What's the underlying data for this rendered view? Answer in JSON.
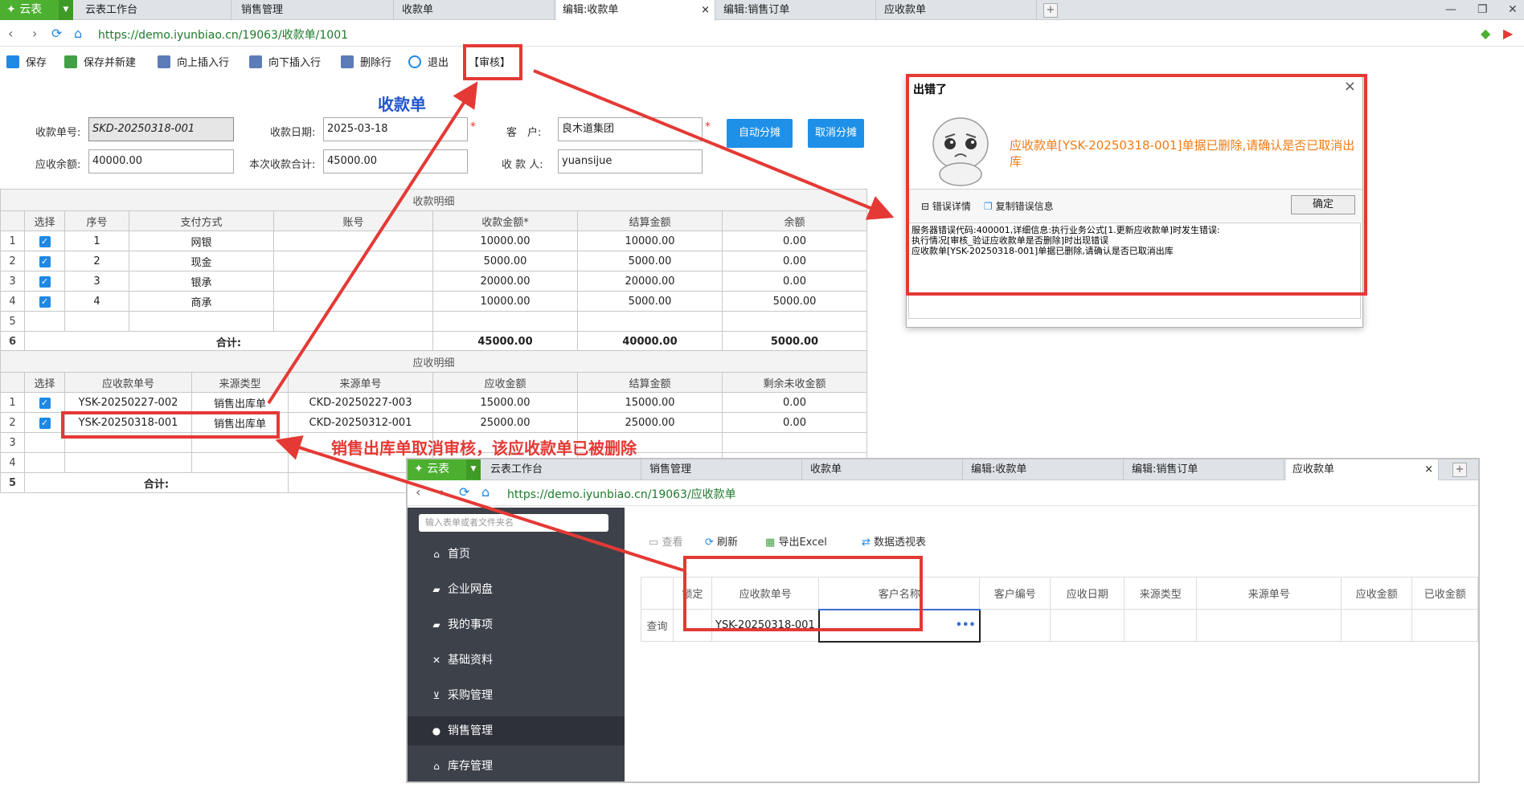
{
  "browser": {
    "app_label": "云表",
    "tabs": [
      {
        "label": "云表工作台",
        "active": false
      },
      {
        "label": "销售管理",
        "active": false
      },
      {
        "label": "收款单",
        "active": false
      },
      {
        "label": "编辑:收款单",
        "active": true
      },
      {
        "label": "编辑:销售订单",
        "active": false
      },
      {
        "label": "应收款单",
        "active": false
      }
    ],
    "close_glyph": "×",
    "url": "https://demo.iyunbiao.cn/19063/收款单/1001"
  },
  "toolbar": {
    "save": "保存",
    "save_new": "保存并新建",
    "insert_up": "向上插入行",
    "insert_down": "向下插入行",
    "delete_row": "删除行",
    "exit": "退出",
    "audit": "【审核】"
  },
  "form": {
    "title": "收款单",
    "doc_no_label": "收款单号:",
    "doc_no": "SKD-20250318-001",
    "date_label": "收款日期:",
    "date": "2025-03-18",
    "customer_label": "客　户:",
    "customer": "良木道集团",
    "balance_label": "应收余额:",
    "balance": "40000.00",
    "total_label": "本次收款合计:",
    "total": "45000.00",
    "payee_label": "收 款 人:",
    "payee": "yuansijue",
    "auto_alloc": "自动分摊",
    "cancel_alloc": "取消分摊"
  },
  "payment_detail": {
    "section": "收款明细",
    "headers": [
      "选择",
      "序号",
      "支付方式",
      "账号",
      "收款金额*",
      "结算金额",
      "余额"
    ],
    "rows": [
      {
        "rn": "1",
        "seq": "1",
        "method": "网银",
        "account": "",
        "amount": "10000.00",
        "settled": "10000.00",
        "rest": "0.00"
      },
      {
        "rn": "2",
        "seq": "2",
        "method": "现金",
        "account": "",
        "amount": "5000.00",
        "settled": "5000.00",
        "rest": "0.00"
      },
      {
        "rn": "3",
        "seq": "3",
        "method": "银承",
        "account": "",
        "amount": "20000.00",
        "settled": "20000.00",
        "rest": "0.00"
      },
      {
        "rn": "4",
        "seq": "4",
        "method": "商承",
        "account": "",
        "amount": "10000.00",
        "settled": "5000.00",
        "rest": "5000.00"
      }
    ],
    "empty_rn": "5",
    "total_rn": "6",
    "total_label": "合计:",
    "total_amount": "45000.00",
    "total_settled": "40000.00",
    "total_rest": "5000.00"
  },
  "receivable_detail": {
    "section": "应收明细",
    "headers": [
      "选择",
      "应收款单号",
      "来源类型",
      "来源单号",
      "应收金额",
      "结算金额",
      "剩余未收金额"
    ],
    "rows": [
      {
        "rn": "1",
        "no": "YSK-20250227-002",
        "type": "销售出库单",
        "src": "CKD-20250227-003",
        "amount": "15000.00",
        "settled": "15000.00",
        "rest": "0.00"
      },
      {
        "rn": "2",
        "no": "YSK-20250318-001",
        "type": "销售出库单",
        "src": "CKD-20250312-001",
        "amount": "25000.00",
        "settled": "25000.00",
        "rest": "0.00"
      }
    ],
    "empty_rns": [
      "3",
      "4"
    ],
    "total_rn": "5",
    "total_label": "合计:"
  },
  "error_dialog": {
    "title": "出错了",
    "message": "应收款单[YSK-20250318-001]单据已删除,请确认是否已取消出库",
    "details_toggle": "错误详情",
    "copy": "复制错误信息",
    "ok": "确定",
    "detail_lines": [
      "服务器错误代码:400001,详细信息:执行业务公式[1.更新应收款单]时发生错误:",
      "执行情况[审核_验证应收款单是否删除]时出现错误",
      "应收款单[YSK-20250318-001]单据已删除,请确认是否已取消出库"
    ]
  },
  "annotation": "销售出库单取消审核，该应收款单已被删除",
  "window2": {
    "app_label": "云表",
    "tabs": [
      {
        "label": "云表工作台",
        "active": false
      },
      {
        "label": "销售管理",
        "active": false
      },
      {
        "label": "收款单",
        "active": false
      },
      {
        "label": "编辑:收款单",
        "active": false
      },
      {
        "label": "编辑:销售订单",
        "active": false
      },
      {
        "label": "应收款单",
        "active": true
      }
    ],
    "url": "https://demo.iyunbiao.cn/19063/应收款单",
    "search_placeholder": "输入表单或者文件夹名",
    "menu": [
      "首页",
      "企业网盘",
      "我的事项",
      "基础资料",
      "采购管理",
      "销售管理",
      "库存管理"
    ],
    "list_toolbar": {
      "view": "查看",
      "refresh": "刷新",
      "export": "导出Excel",
      "pivot": "数据透视表"
    },
    "columns": [
      "锁定",
      "应收款单号",
      "客户名称",
      "客户编号",
      "应收日期",
      "来源类型",
      "来源单号",
      "应收金额",
      "已收金额"
    ],
    "query_label": "查询",
    "query_value": "YSK-20250318-001",
    "ellipsis": "•••"
  },
  "colors": {
    "accent": "#1e90e8",
    "brand_green": "#4caf30",
    "alert_red": "#e53935",
    "message_orange": "#f07b14"
  }
}
